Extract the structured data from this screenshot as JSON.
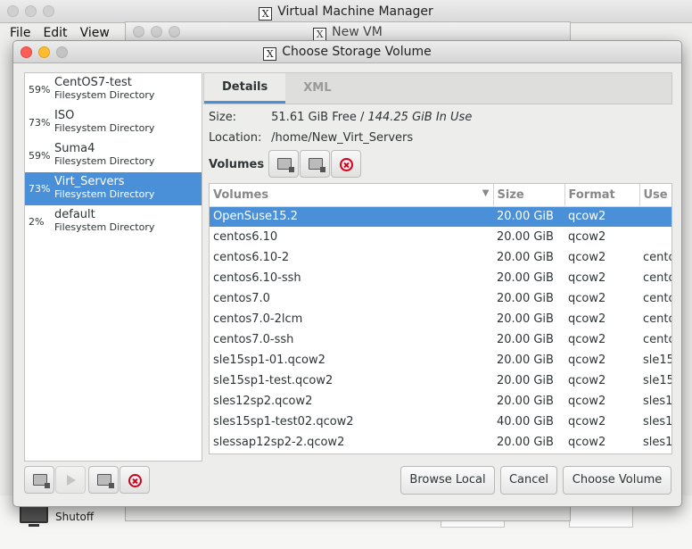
{
  "vmm": {
    "title": "Virtual Machine Manager",
    "menu": [
      "File",
      "Edit",
      "View"
    ],
    "vm_status": "Shutoff"
  },
  "newvm": {
    "title": "New VM"
  },
  "dialog": {
    "title": "Choose Storage Volume",
    "pools": [
      {
        "pct": "59%",
        "name": "CentOS7-test",
        "type": "Filesystem Directory"
      },
      {
        "pct": "73%",
        "name": "ISO",
        "type": "Filesystem Directory"
      },
      {
        "pct": "59%",
        "name": "Suma4",
        "type": "Filesystem Directory"
      },
      {
        "pct": "73%",
        "name": "Virt_Servers",
        "type": "Filesystem Directory"
      },
      {
        "pct": "2%",
        "name": "default",
        "type": "Filesystem Directory"
      }
    ],
    "selected_pool": 3,
    "tabs": {
      "details": "Details",
      "xml": "XML"
    },
    "size_label": "Size:",
    "size_free": "51.61 GiB Free /",
    "size_in_use": "144.25 GiB In Use",
    "location_label": "Location:",
    "location_value": "/home/New_Virt_Servers",
    "volumes_label": "Volumes",
    "columns": [
      "Volumes",
      "Size",
      "Format",
      "Use"
    ],
    "volumes": [
      {
        "name": "OpenSuse15.2",
        "size": "20.00 GiB",
        "format": "qcow2",
        "use": ""
      },
      {
        "name": "centos6.10",
        "size": "20.00 GiB",
        "format": "qcow2",
        "use": ""
      },
      {
        "name": "centos6.10-2",
        "size": "20.00 GiB",
        "format": "qcow2",
        "use": "cento"
      },
      {
        "name": "centos6.10-ssh",
        "size": "20.00 GiB",
        "format": "qcow2",
        "use": "cento"
      },
      {
        "name": "centos7.0",
        "size": "20.00 GiB",
        "format": "qcow2",
        "use": "cento"
      },
      {
        "name": "centos7.0-2lcm",
        "size": "20.00 GiB",
        "format": "qcow2",
        "use": "cento"
      },
      {
        "name": "centos7.0-ssh",
        "size": "20.00 GiB",
        "format": "qcow2",
        "use": "cento"
      },
      {
        "name": "sle15sp1-01.qcow2",
        "size": "20.00 GiB",
        "format": "qcow2",
        "use": "sle15"
      },
      {
        "name": "sle15sp1-test.qcow2",
        "size": "20.00 GiB",
        "format": "qcow2",
        "use": "sle15"
      },
      {
        "name": "sles12sp2.qcow2",
        "size": "20.00 GiB",
        "format": "qcow2",
        "use": "sles1"
      },
      {
        "name": "sles15sp1-test02.qcow2",
        "size": "40.00 GiB",
        "format": "qcow2",
        "use": "sles1"
      },
      {
        "name": "slessap12sp2-2.qcow2",
        "size": "20.00 GiB",
        "format": "qcow2",
        "use": "sles1"
      }
    ],
    "selected_volume": 0,
    "buttons": {
      "browse_local": "Browse Local",
      "cancel": "Cancel",
      "choose_volume": "Choose Volume"
    }
  }
}
